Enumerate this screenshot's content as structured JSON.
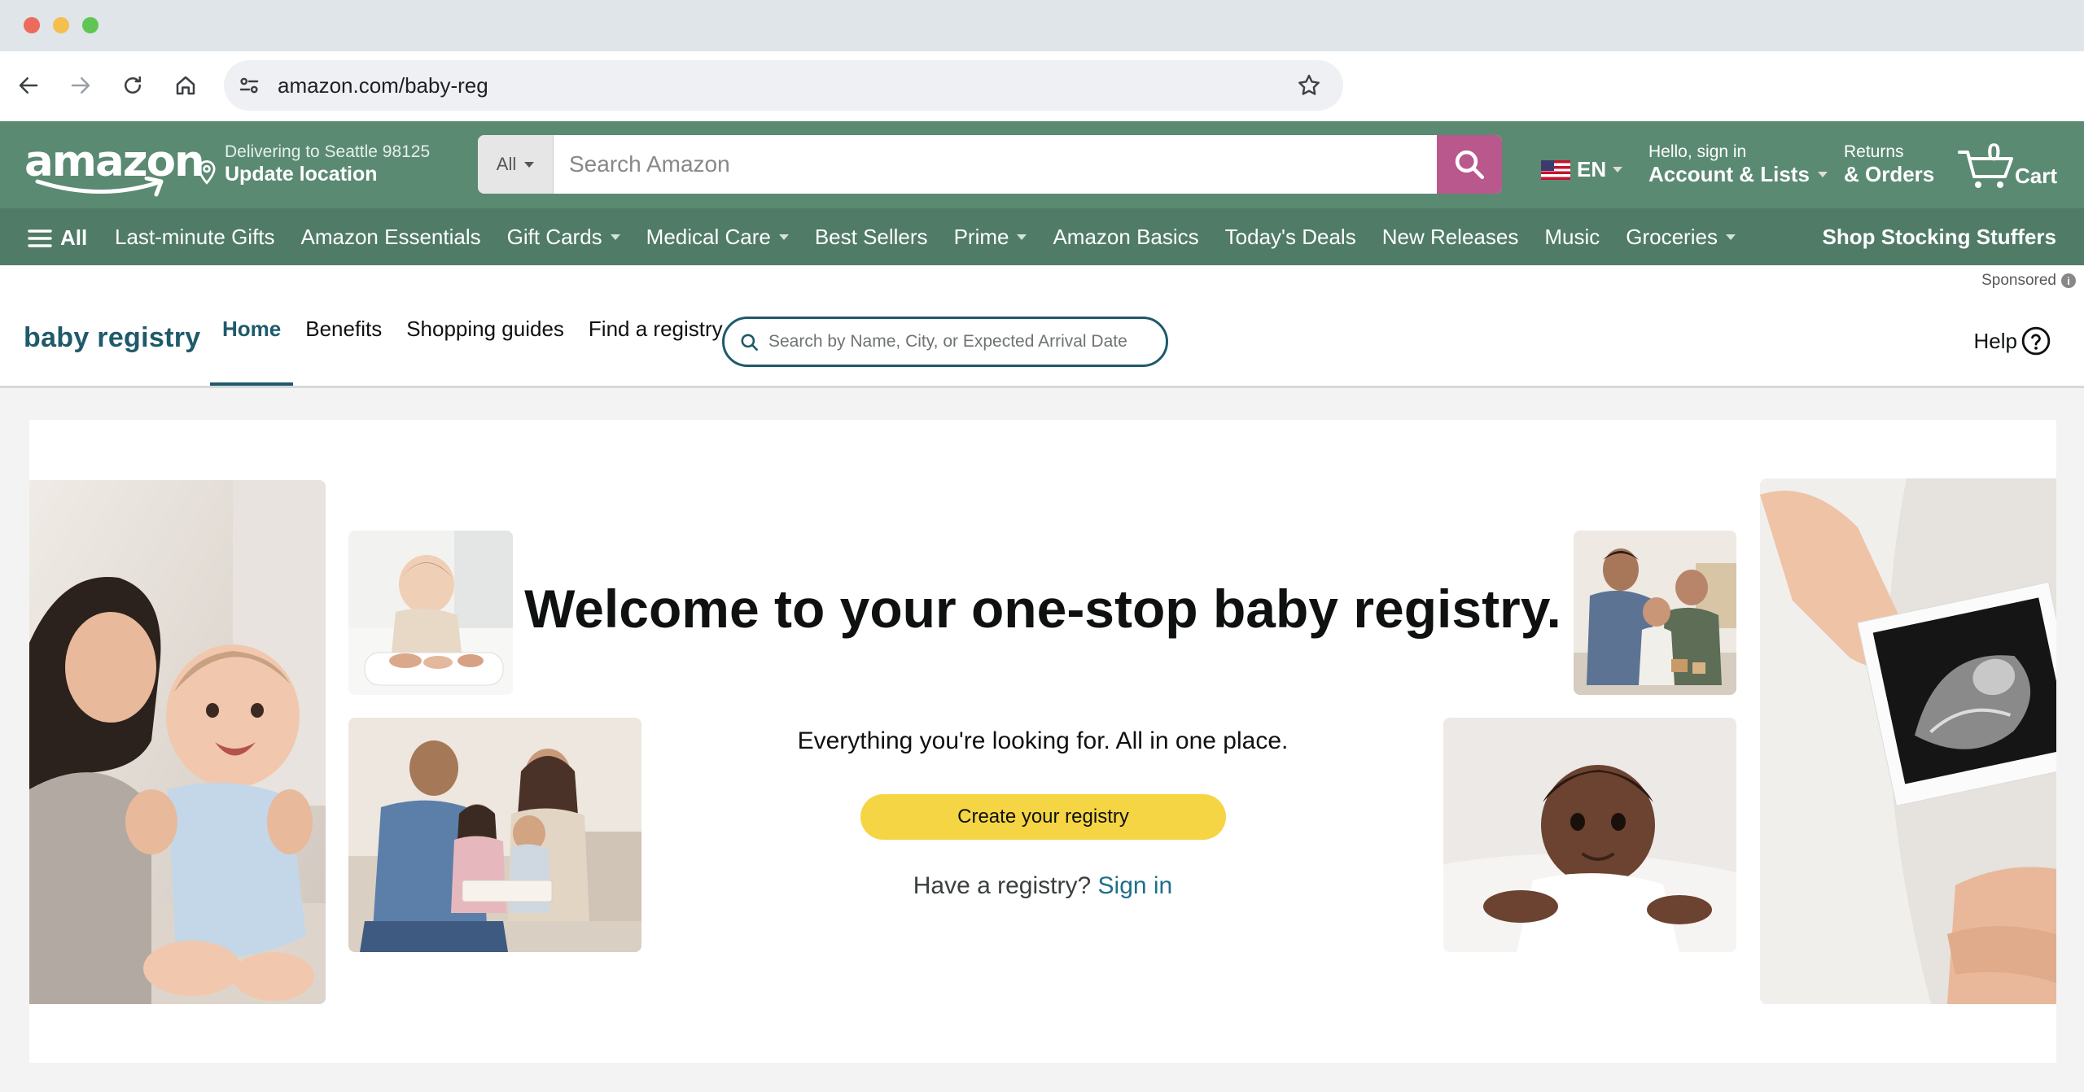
{
  "browser": {
    "url": "amazon.com/baby-reg"
  },
  "header": {
    "deliver_line1": "Delivering to Seattle 98125",
    "deliver_line2": "Update location",
    "search_category": "All",
    "search_placeholder": "Search Amazon",
    "language": "EN",
    "account_line1": "Hello, sign in",
    "account_line2": "Account & Lists",
    "returns_line1": "Returns",
    "returns_line2": "& Orders",
    "cart_count": "0",
    "cart_label": "Cart",
    "colors": {
      "header_bg": "#5b8a73",
      "nav_bg": "#4f7b67",
      "search_button": "#b9588d"
    }
  },
  "nav": {
    "all_label": "All",
    "items": [
      {
        "label": "Last-minute Gifts",
        "dropdown": false
      },
      {
        "label": "Amazon Essentials",
        "dropdown": false
      },
      {
        "label": "Gift Cards",
        "dropdown": true
      },
      {
        "label": "Medical Care",
        "dropdown": true
      },
      {
        "label": "Best Sellers",
        "dropdown": false
      },
      {
        "label": "Prime",
        "dropdown": true
      },
      {
        "label": "Amazon Basics",
        "dropdown": false
      },
      {
        "label": "Today's Deals",
        "dropdown": false
      },
      {
        "label": "New Releases",
        "dropdown": false
      },
      {
        "label": "Music",
        "dropdown": false
      },
      {
        "label": "Groceries",
        "dropdown": true
      }
    ],
    "promo": "Shop Stocking Stuffers"
  },
  "registry_nav": {
    "sponsored": "Sponsored",
    "brand": "baby registry",
    "tabs": [
      "Home",
      "Benefits",
      "Shopping guides",
      "Find a registry"
    ],
    "active_tab": "Home",
    "search_placeholder": "Search by Name, City, or Expected Arrival Date",
    "help": "Help",
    "accent": "#1f5a6b"
  },
  "hero": {
    "headline": "Welcome to your one-stop baby registry.",
    "subheadline": "Everything you're looking for. All in one place.",
    "cta": "Create your registry",
    "have_registry": "Have a registry?",
    "sign_in": "Sign in",
    "cta_color": "#f5d544"
  }
}
